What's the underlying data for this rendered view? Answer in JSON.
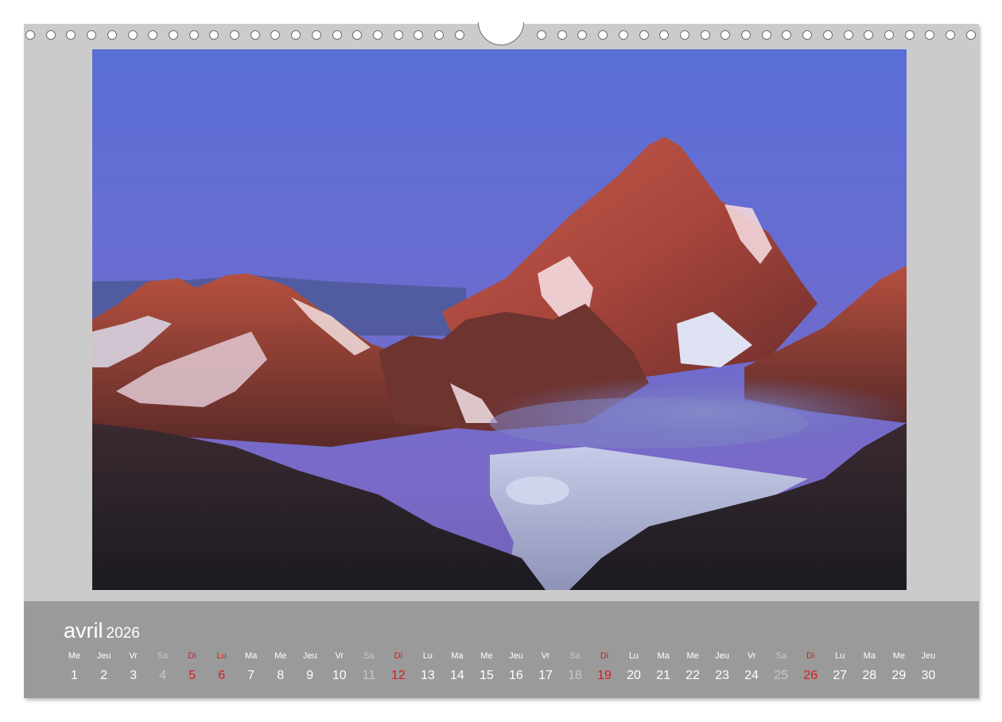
{
  "calendar": {
    "month": "avril",
    "year": "2026",
    "days": [
      {
        "weekday": "Me",
        "date": "1",
        "type": "normal"
      },
      {
        "weekday": "Jeu",
        "date": "2",
        "type": "normal"
      },
      {
        "weekday": "Vr",
        "date": "3",
        "type": "normal"
      },
      {
        "weekday": "Sa",
        "date": "4",
        "type": "sat"
      },
      {
        "weekday": "Di",
        "date": "5",
        "type": "sun"
      },
      {
        "weekday": "Lu",
        "date": "6",
        "type": "sun"
      },
      {
        "weekday": "Ma",
        "date": "7",
        "type": "normal"
      },
      {
        "weekday": "Me",
        "date": "8",
        "type": "normal"
      },
      {
        "weekday": "Jeu",
        "date": "9",
        "type": "normal"
      },
      {
        "weekday": "Vr",
        "date": "10",
        "type": "normal"
      },
      {
        "weekday": "Sa",
        "date": "11",
        "type": "sat"
      },
      {
        "weekday": "Di",
        "date": "12",
        "type": "sun"
      },
      {
        "weekday": "Lu",
        "date": "13",
        "type": "normal"
      },
      {
        "weekday": "Ma",
        "date": "14",
        "type": "normal"
      },
      {
        "weekday": "Me",
        "date": "15",
        "type": "normal"
      },
      {
        "weekday": "Jeu",
        "date": "16",
        "type": "normal"
      },
      {
        "weekday": "Vr",
        "date": "17",
        "type": "normal"
      },
      {
        "weekday": "Sa",
        "date": "18",
        "type": "sat"
      },
      {
        "weekday": "Di",
        "date": "19",
        "type": "sun"
      },
      {
        "weekday": "Lu",
        "date": "20",
        "type": "normal"
      },
      {
        "weekday": "Ma",
        "date": "21",
        "type": "normal"
      },
      {
        "weekday": "Me",
        "date": "22",
        "type": "normal"
      },
      {
        "weekday": "Jeu",
        "date": "23",
        "type": "normal"
      },
      {
        "weekday": "Vr",
        "date": "24",
        "type": "normal"
      },
      {
        "weekday": "Sa",
        "date": "25",
        "type": "sat"
      },
      {
        "weekday": "Di",
        "date": "26",
        "type": "sun"
      },
      {
        "weekday": "Lu",
        "date": "27",
        "type": "normal"
      },
      {
        "weekday": "Ma",
        "date": "28",
        "type": "normal"
      },
      {
        "weekday": "Me",
        "date": "29",
        "type": "normal"
      },
      {
        "weekday": "Jeu",
        "date": "30",
        "type": "normal"
      }
    ]
  },
  "photo": {
    "subject": "mountain-peak-alpenglow-photo"
  },
  "colors": {
    "page_background": "#cbcbcb",
    "month_bar": "#9a9a9a",
    "weekend_saturday": "#c9c9c9",
    "holiday_sunday": "#d81e1e",
    "text": "#ffffff"
  }
}
